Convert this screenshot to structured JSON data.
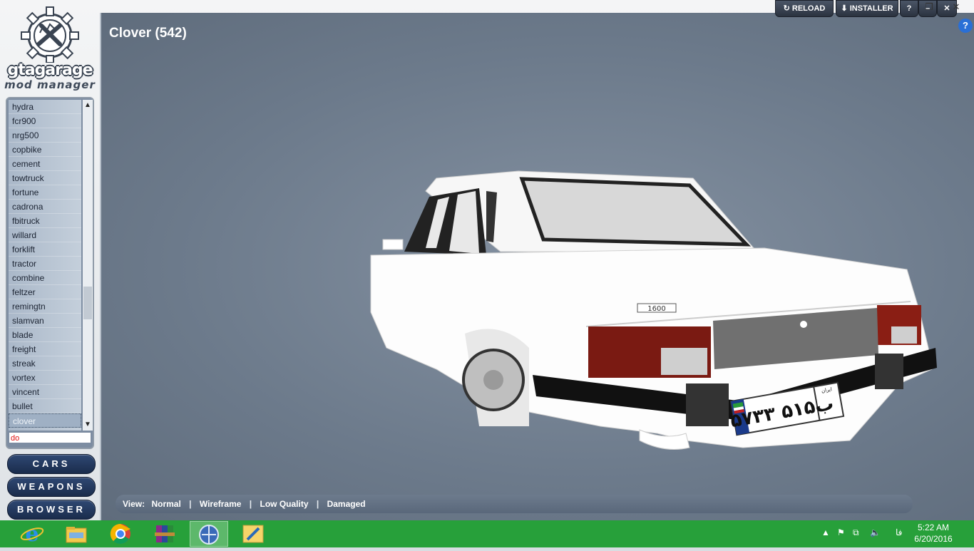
{
  "window": {
    "title": "Clover (542)",
    "reload_label": "RELOAD",
    "installer_label": "INSTALLER",
    "help_label": "?",
    "minimize_label": "–",
    "close_label": "✕"
  },
  "logo": {
    "text": "gtagarage",
    "subtitle": "mod manager"
  },
  "vehicle_list": {
    "items": [
      "hydra",
      "fcr900",
      "nrg500",
      "copbike",
      "cement",
      "towtruck",
      "fortune",
      "cadrona",
      "fbitruck",
      "willard",
      "forklift",
      "tractor",
      "combine",
      "feltzer",
      "remingtn",
      "slamvan",
      "blade",
      "freight",
      "streak",
      "vortex",
      "vincent",
      "bullet",
      "clover"
    ],
    "selected": "clover",
    "search_value": "do"
  },
  "nav": {
    "cars": "CARS",
    "weapons": "WEAPONS",
    "browser": "BROWSER"
  },
  "view_bar": {
    "label": "View:",
    "options": [
      "Normal",
      "Wireframe",
      "Low Quality",
      "Damaged"
    ]
  },
  "car": {
    "plate_text": "۵۷ب۵۱۵ ۳۳",
    "plate_country": "ایران",
    "badge": "1600"
  },
  "taskbar": {
    "time": "5:22 AM",
    "date": "6/20/2016",
    "lang": "فا"
  },
  "colors": {
    "taskbar": "#27a03a",
    "nav_button": "#2f4873",
    "viewer_bg": "#7a8898"
  }
}
